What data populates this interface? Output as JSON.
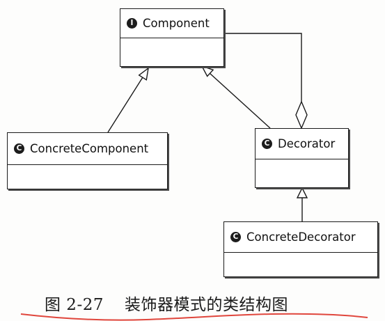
{
  "classes": {
    "component": {
      "name": "Component",
      "icon": "I",
      "icon_name": "interface-icon"
    },
    "concrete_component": {
      "name": "ConcreteComponent",
      "icon": "C",
      "icon_name": "class-icon"
    },
    "decorator": {
      "name": "Decorator",
      "icon": "C",
      "icon_name": "class-icon"
    },
    "concrete_decorator": {
      "name": "ConcreteDecorator",
      "icon": "C",
      "icon_name": "class-icon"
    }
  },
  "relationships": [
    {
      "from": "ConcreteComponent",
      "to": "Component",
      "type": "generalization"
    },
    {
      "from": "Decorator",
      "to": "Component",
      "type": "generalization"
    },
    {
      "from": "ConcreteDecorator",
      "to": "Decorator",
      "type": "generalization"
    },
    {
      "from": "Decorator",
      "to": "Component",
      "type": "aggregation"
    }
  ],
  "caption": {
    "figure_number": "图 2-27",
    "title": "装饰器模式的类结构图"
  },
  "colors": {
    "line": "#1a1a1a",
    "underline": "#e0463c"
  }
}
